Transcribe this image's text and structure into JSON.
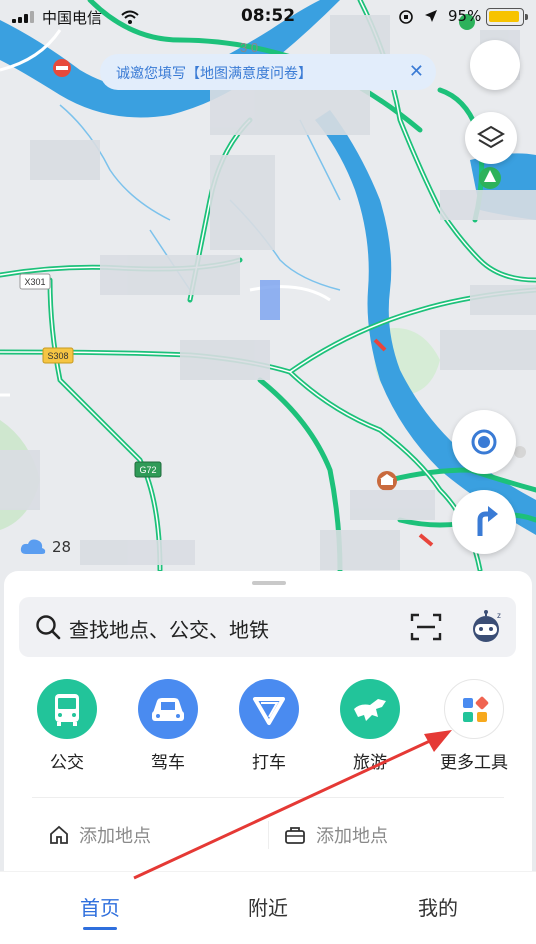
{
  "status_bar": {
    "carrier": "中国电信",
    "time": "08:52",
    "battery": "95%"
  },
  "survey_banner": {
    "text": "诚邀您填写【地图满意度问卷】",
    "close": "✕"
  },
  "map": {
    "road_labels": {
      "x301": "X301",
      "s308": "S308",
      "g72": "G72"
    },
    "weather_temp": "28"
  },
  "search": {
    "placeholder": "查找地点、公交、地铁"
  },
  "tools": [
    {
      "label": "公交",
      "color": "#22c49a"
    },
    {
      "label": "驾车",
      "color": "#4a8bf0"
    },
    {
      "label": "打车",
      "color": "#4a8bf0"
    },
    {
      "label": "旅游",
      "color": "#22c49a"
    },
    {
      "label": "更多工具",
      "color": "#ffffff"
    }
  ],
  "quick_places": {
    "home": "添加地点",
    "work": "添加地点"
  },
  "tabs": [
    {
      "label": "首页",
      "active": true
    },
    {
      "label": "附近",
      "active": false
    },
    {
      "label": "我的",
      "active": false
    }
  ],
  "colors": {
    "road": "#1dc17a",
    "water": "#3aa0e0",
    "accent": "#2f6fdd",
    "annotation": "#e53935"
  }
}
